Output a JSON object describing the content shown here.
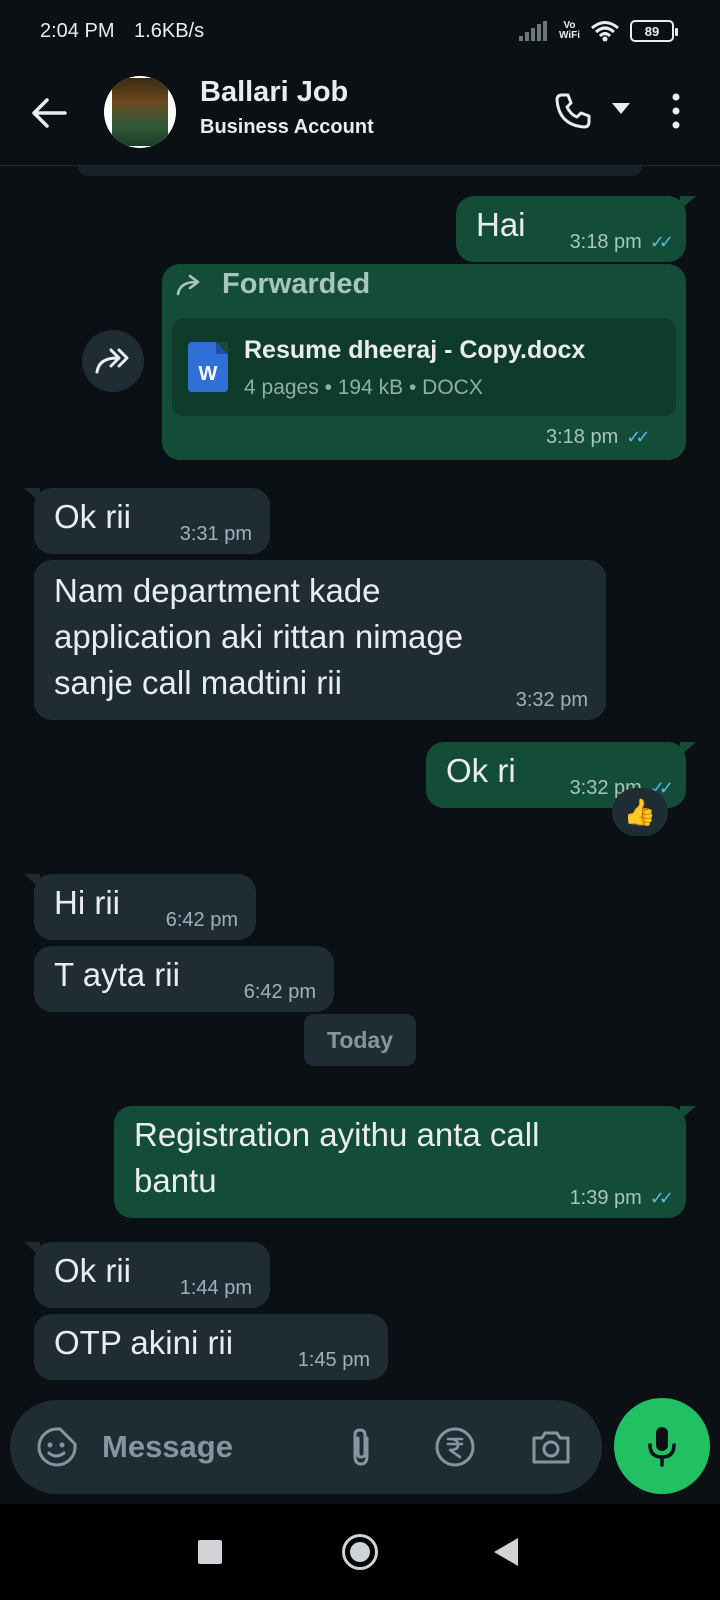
{
  "status_bar": {
    "time": "2:04 PM",
    "speed": "1.6KB/s",
    "vowifi_top": "Vo",
    "vowifi_bottom": "WiFi",
    "battery": "89"
  },
  "header": {
    "contact_name": "Ballari Job",
    "contact_subtitle": "Business Account"
  },
  "messages": [
    {
      "text": "Hai",
      "time": "3:18 pm"
    },
    {
      "forward_label": "Forwarded",
      "doc_name": "Resume dheeraj - Copy.docx",
      "doc_info": "4 pages • 194 kB • DOCX",
      "doc_icon_letter": "W",
      "time": "3:18 pm"
    },
    {
      "text": "Ok rii",
      "time": "3:31 pm"
    },
    {
      "text_lines": [
        "Nam department kade",
        "application aki rittan nimage",
        "sanje call madtini rii"
      ],
      "time": "3:32 pm"
    },
    {
      "text": "Ok ri",
      "time": "3:32 pm",
      "reaction": "👍"
    },
    {
      "text": "Hi rii",
      "time": "6:42 pm"
    },
    {
      "text": "T ayta rii",
      "time": "6:42 pm"
    },
    {
      "date_chip": "Today"
    },
    {
      "text_lines": [
        "Registration ayithu anta call",
        "bantu"
      ],
      "time": "1:39 pm"
    },
    {
      "text": "Ok rii",
      "time": "1:44 pm"
    },
    {
      "text": "OTP akini rii",
      "time": "1:45 pm"
    }
  ],
  "input": {
    "placeholder": "Message"
  },
  "colors": {
    "background": "#0b1014",
    "outgoing_bubble": "#134d37",
    "incoming_bubble": "#1f2c34",
    "accent_green": "#21c063",
    "read_ticks": "#53bdeb"
  }
}
